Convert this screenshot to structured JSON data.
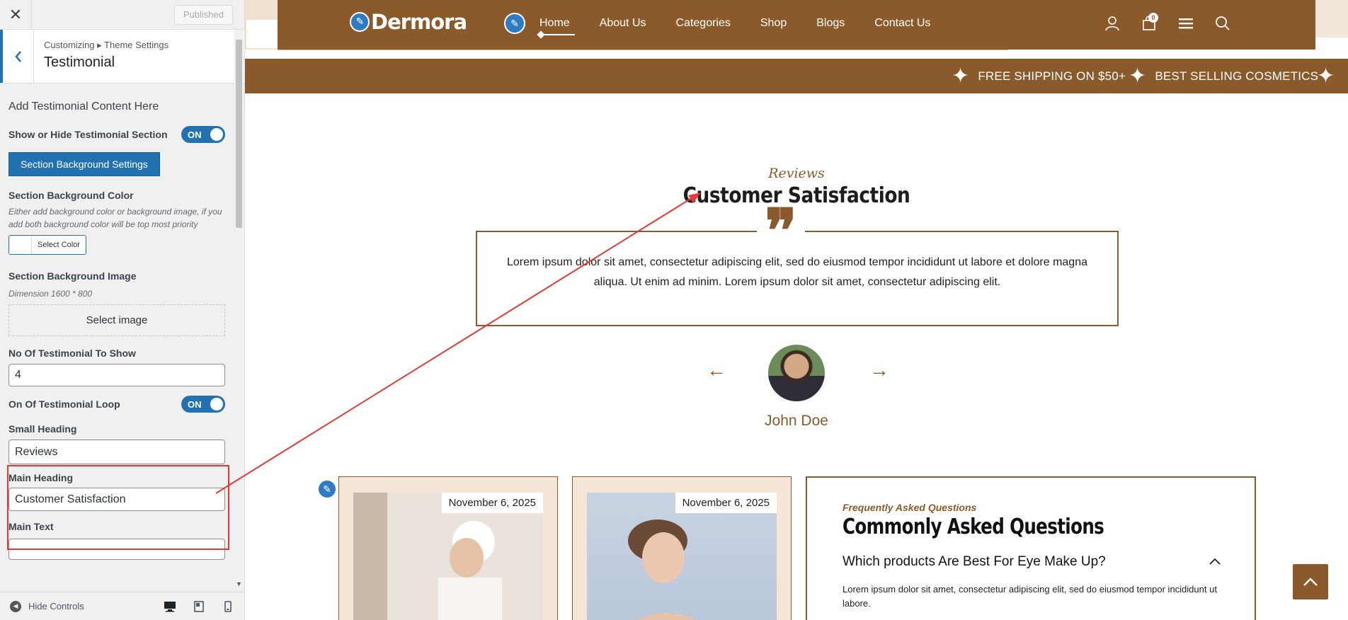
{
  "sidebar": {
    "close_label": "✕",
    "publish_label": "Published",
    "breadcrumb": "Customizing ▸ Theme Settings",
    "section_title": "Testimonial",
    "intro": "Add Testimonial Content Here",
    "show_label": "Show or Hide Testimonial Section",
    "show_toggle": "ON",
    "bg_settings_button": "Section Background Settings",
    "bg_color_label": "Section Background Color",
    "bg_color_desc": "Either add background color or background image, if you add both background color will be top most priority",
    "select_color": "Select Color",
    "bg_image_label": "Section Background Image",
    "bg_image_desc": "Dimension 1600 * 800",
    "select_image": "Select image",
    "count_label": "No Of Testimonial To Show",
    "count_value": "4",
    "loop_label": "On Of Testimonial Loop",
    "loop_toggle": "ON",
    "small_heading_label": "Small Heading",
    "small_heading_value": "Reviews",
    "main_heading_label": "Main Heading",
    "main_heading_value": "Customer Satisfaction",
    "main_text_label": "Main Text",
    "hide_controls": "Hide Controls"
  },
  "header": {
    "logo": "Dermora",
    "nav": [
      "Home",
      "About Us",
      "Categories",
      "Shop",
      "Blogs",
      "Contact Us"
    ],
    "cart_count": "0"
  },
  "ticker": [
    "FREE SHIPPING ON $50+",
    "BEST SELLING COSMETICS"
  ],
  "testimonial": {
    "small_heading": "Reviews",
    "main_heading": "Customer Satisfaction",
    "quote": "Lorem ipsum dolor sit amet, consectetur adipiscing elit, sed do eiusmod tempor incididunt ut labore et dolore magna aliqua. Ut enim ad minim. Lorem ipsum dolor sit amet, consectetur adipiscing elit.",
    "name": "John Doe"
  },
  "blog_cards": [
    {
      "date": "November 6, 2025"
    },
    {
      "date": "November 6, 2025"
    }
  ],
  "faq": {
    "small_heading": "Frequently Asked Questions",
    "main_heading": "Commonly Asked Questions",
    "question": "Which products Are Best For Eye Make Up?",
    "answer": "Lorem ipsum dolor sit amet, consectetur adipiscing elit, sed do eiusmod tempor incididunt ut labore."
  },
  "colors": {
    "brand": "#8b5a2b",
    "wp_blue": "#2271b1",
    "highlight": "#e53935"
  }
}
